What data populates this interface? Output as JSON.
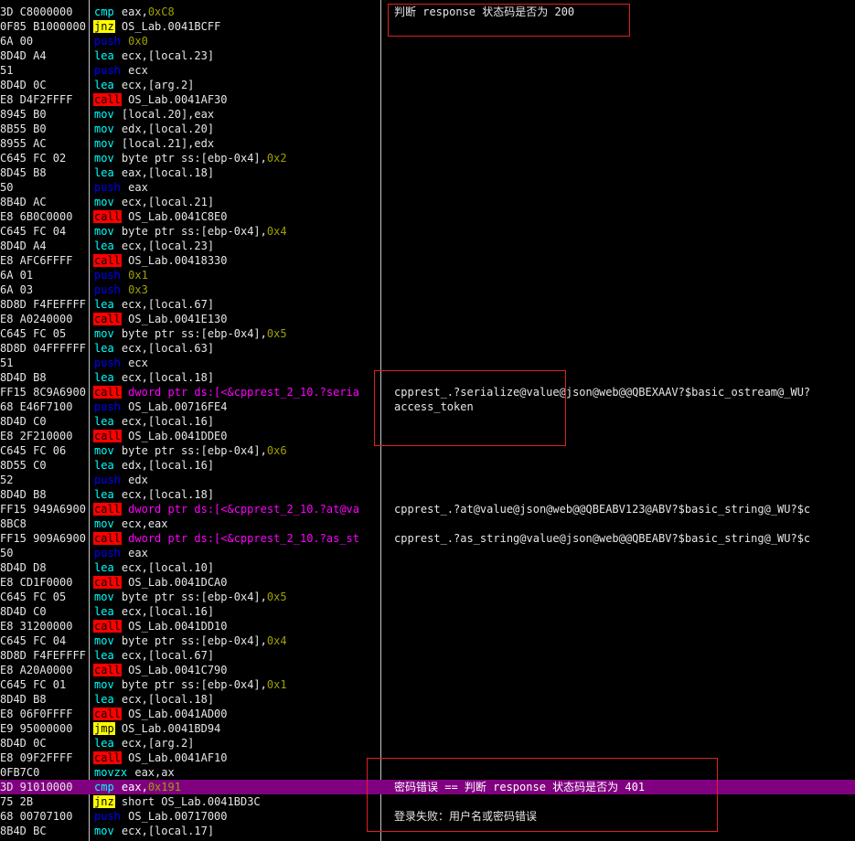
{
  "rows": [
    {
      "hex": "3D C8000000",
      "mn": "cmp",
      "cls": "k-cmp",
      "op": "eax,",
      "imm": "0xC8",
      "cmt": "判断 response 状态码是否为 200"
    },
    {
      "hex": "0F85 B1000000",
      "mn": "jnz",
      "cls": "k-jnz",
      "op": "OS_Lab.0041BCFF",
      "imm": "",
      "cmt": ""
    },
    {
      "hex": "6A 00",
      "mn": "push",
      "cls": "k-push",
      "op": "",
      "imm": "0x0",
      "cmt": ""
    },
    {
      "hex": "8D4D A4",
      "mn": "lea",
      "cls": "k-lea",
      "op": "ecx,[local.23]",
      "imm": "",
      "cmt": ""
    },
    {
      "hex": "51",
      "mn": "push",
      "cls": "k-push",
      "op": "ecx",
      "imm": "",
      "cmt": ""
    },
    {
      "hex": "8D4D 0C",
      "mn": "lea",
      "cls": "k-lea",
      "op": "ecx,[arg.2]",
      "imm": "",
      "cmt": ""
    },
    {
      "hex": "E8 D4F2FFFF",
      "mn": "call",
      "cls": "k-call",
      "op": "OS_Lab.0041AF30",
      "imm": "",
      "cmt": ""
    },
    {
      "hex": "8945 B0",
      "mn": "mov",
      "cls": "k-mov",
      "op": "[local.20],eax",
      "imm": "",
      "cmt": ""
    },
    {
      "hex": "8B55 B0",
      "mn": "mov",
      "cls": "k-mov",
      "op": "edx,[local.20]",
      "imm": "",
      "cmt": ""
    },
    {
      "hex": "8955 AC",
      "mn": "mov",
      "cls": "k-mov",
      "op": "[local.21],edx",
      "imm": "",
      "cmt": ""
    },
    {
      "hex": "C645 FC 02",
      "mn": "mov",
      "cls": "k-mov",
      "op": "byte ptr ss:[ebp-0x4],",
      "imm": "0x2",
      "cmt": ""
    },
    {
      "hex": "8D45 B8",
      "mn": "lea",
      "cls": "k-lea",
      "op": "eax,[local.18]",
      "imm": "",
      "cmt": ""
    },
    {
      "hex": "50",
      "mn": "push",
      "cls": "k-push",
      "op": "eax",
      "imm": "",
      "cmt": ""
    },
    {
      "hex": "8B4D AC",
      "mn": "mov",
      "cls": "k-mov",
      "op": "ecx,[local.21]",
      "imm": "",
      "cmt": ""
    },
    {
      "hex": "E8 6B0C0000",
      "mn": "call",
      "cls": "k-call",
      "op": "OS_Lab.0041C8E0",
      "imm": "",
      "cmt": ""
    },
    {
      "hex": "C645 FC 04",
      "mn": "mov",
      "cls": "k-mov",
      "op": "byte ptr ss:[ebp-0x4],",
      "imm": "0x4",
      "cmt": ""
    },
    {
      "hex": "8D4D A4",
      "mn": "lea",
      "cls": "k-lea",
      "op": "ecx,[local.23]",
      "imm": "",
      "cmt": ""
    },
    {
      "hex": "E8 AFC6FFFF",
      "mn": "call",
      "cls": "k-call",
      "op": "OS_Lab.00418330",
      "imm": "",
      "cmt": ""
    },
    {
      "hex": "6A 01",
      "mn": "push",
      "cls": "k-push",
      "op": "",
      "imm": "0x1",
      "cmt": ""
    },
    {
      "hex": "6A 03",
      "mn": "push",
      "cls": "k-push",
      "op": "",
      "imm": "0x3",
      "cmt": ""
    },
    {
      "hex": "8D8D F4FEFFFF",
      "mn": "lea",
      "cls": "k-lea",
      "op": "ecx,[local.67]",
      "imm": "",
      "cmt": ""
    },
    {
      "hex": "E8 A0240000",
      "mn": "call",
      "cls": "k-call",
      "op": "OS_Lab.0041E130",
      "imm": "",
      "cmt": ""
    },
    {
      "hex": "C645 FC 05",
      "mn": "mov",
      "cls": "k-mov",
      "op": "byte ptr ss:[ebp-0x4],",
      "imm": "0x5",
      "cmt": ""
    },
    {
      "hex": "8D8D 04FFFFFF",
      "mn": "lea",
      "cls": "k-lea",
      "op": "ecx,[local.63]",
      "imm": "",
      "cmt": ""
    },
    {
      "hex": "51",
      "mn": "push",
      "cls": "k-push",
      "op": "ecx",
      "imm": "",
      "cmt": ""
    },
    {
      "hex": "8D4D B8",
      "mn": "lea",
      "cls": "k-lea",
      "op": "ecx,[local.18]",
      "imm": "",
      "cmt": ""
    },
    {
      "hex": "FF15 8C9A6900",
      "mn": "call",
      "cls": "k-call",
      "op": "dword ptr ds:[<&cpprest_2_10.?seria",
      "imm": "",
      "cmt": "cpprest_.?serialize@value@json@web@@QBEXAAV?$basic_ostream@_WU?"
    },
    {
      "hex": "68 E46F7100",
      "mn": "push",
      "cls": "k-push",
      "op": "OS_Lab.00716FE4",
      "imm": "",
      "cmt": "access_token"
    },
    {
      "hex": "8D4D C0",
      "mn": "lea",
      "cls": "k-lea",
      "op": "ecx,[local.16]",
      "imm": "",
      "cmt": ""
    },
    {
      "hex": "E8 2F210000",
      "mn": "call",
      "cls": "k-call",
      "op": "OS_Lab.0041DDE0",
      "imm": "",
      "cmt": ""
    },
    {
      "hex": "C645 FC 06",
      "mn": "mov",
      "cls": "k-mov",
      "op": "byte ptr ss:[ebp-0x4],",
      "imm": "0x6",
      "cmt": ""
    },
    {
      "hex": "8D55 C0",
      "mn": "lea",
      "cls": "k-lea",
      "op": "edx,[local.16]",
      "imm": "",
      "cmt": ""
    },
    {
      "hex": "52",
      "mn": "push",
      "cls": "k-push",
      "op": "edx",
      "imm": "",
      "cmt": ""
    },
    {
      "hex": "8D4D B8",
      "mn": "lea",
      "cls": "k-lea",
      "op": "ecx,[local.18]",
      "imm": "",
      "cmt": ""
    },
    {
      "hex": "FF15 949A6900",
      "mn": "call",
      "cls": "k-call",
      "op": "dword ptr ds:[<&cpprest_2_10.?at@va",
      "imm": "",
      "cmt": "cpprest_.?at@value@json@web@@QBEABV123@ABV?$basic_string@_WU?$c"
    },
    {
      "hex": "8BC8",
      "mn": "mov",
      "cls": "k-mov",
      "op": "ecx,eax",
      "imm": "",
      "cmt": ""
    },
    {
      "hex": "FF15 909A6900",
      "mn": "call",
      "cls": "k-call",
      "op": "dword ptr ds:[<&cpprest_2_10.?as_st",
      "imm": "",
      "cmt": "cpprest_.?as_string@value@json@web@@QBEABV?$basic_string@_WU?$c"
    },
    {
      "hex": "50",
      "mn": "push",
      "cls": "k-push",
      "op": "eax",
      "imm": "",
      "cmt": ""
    },
    {
      "hex": "8D4D D8",
      "mn": "lea",
      "cls": "k-lea",
      "op": "ecx,[local.10]",
      "imm": "",
      "cmt": ""
    },
    {
      "hex": "E8 CD1F0000",
      "mn": "call",
      "cls": "k-call",
      "op": "OS_Lab.0041DCA0",
      "imm": "",
      "cmt": ""
    },
    {
      "hex": "C645 FC 05",
      "mn": "mov",
      "cls": "k-mov",
      "op": "byte ptr ss:[ebp-0x4],",
      "imm": "0x5",
      "cmt": ""
    },
    {
      "hex": "8D4D C0",
      "mn": "lea",
      "cls": "k-lea",
      "op": "ecx,[local.16]",
      "imm": "",
      "cmt": ""
    },
    {
      "hex": "E8 31200000",
      "mn": "call",
      "cls": "k-call",
      "op": "OS_Lab.0041DD10",
      "imm": "",
      "cmt": ""
    },
    {
      "hex": "C645 FC 04",
      "mn": "mov",
      "cls": "k-mov",
      "op": "byte ptr ss:[ebp-0x4],",
      "imm": "0x4",
      "cmt": ""
    },
    {
      "hex": "8D8D F4FEFFFF",
      "mn": "lea",
      "cls": "k-lea",
      "op": "ecx,[local.67]",
      "imm": "",
      "cmt": ""
    },
    {
      "hex": "E8 A20A0000",
      "mn": "call",
      "cls": "k-call",
      "op": "OS_Lab.0041C790",
      "imm": "",
      "cmt": ""
    },
    {
      "hex": "C645 FC 01",
      "mn": "mov",
      "cls": "k-mov",
      "op": "byte ptr ss:[ebp-0x4],",
      "imm": "0x1",
      "cmt": ""
    },
    {
      "hex": "8D4D B8",
      "mn": "lea",
      "cls": "k-lea",
      "op": "ecx,[local.18]",
      "imm": "",
      "cmt": ""
    },
    {
      "hex": "E8 06F0FFFF",
      "mn": "call",
      "cls": "k-call",
      "op": "OS_Lab.0041AD00",
      "imm": "",
      "cmt": ""
    },
    {
      "hex": "E9 95000000",
      "mn": "jmp",
      "cls": "k-jmp",
      "op": "OS_Lab.0041BD94",
      "imm": "",
      "cmt": ""
    },
    {
      "hex": "8D4D 0C",
      "mn": "lea",
      "cls": "k-lea",
      "op": "ecx,[arg.2]",
      "imm": "",
      "cmt": ""
    },
    {
      "hex": "E8 09F2FFFF",
      "mn": "call",
      "cls": "k-call",
      "op": "OS_Lab.0041AF10",
      "imm": "",
      "cmt": ""
    },
    {
      "hex": "0FB7C0",
      "mn": "movzx",
      "cls": "k-movzx",
      "op": "eax,ax",
      "imm": "",
      "cmt": ""
    },
    {
      "hex": "3D 91010000",
      "mn": "cmp",
      "cls": "k-cmp",
      "op": "eax,",
      "imm": "0x191",
      "cmt": "密码错误 == 判断 response 状态码是否为 401",
      "hl": true
    },
    {
      "hex": "75 2B",
      "mn": "jnz",
      "cls": "k-jnz",
      "op": "short OS_Lab.0041BD3C",
      "imm": "",
      "cmt": ""
    },
    {
      "hex": "68 00707100",
      "mn": "push",
      "cls": "k-push",
      "op": "OS_Lab.00717000",
      "imm": "",
      "cmt": "登录失败：用户名或密码错误"
    },
    {
      "hex": "8B4D BC",
      "mn": "mov",
      "cls": "k-mov",
      "op": "ecx,[local.17]",
      "imm": "",
      "cmt": ""
    }
  ],
  "colors": {
    "background": "#000000",
    "highlight_row": "#800080",
    "annotation_box": "#e02020",
    "separator": "#c8c8c8"
  }
}
